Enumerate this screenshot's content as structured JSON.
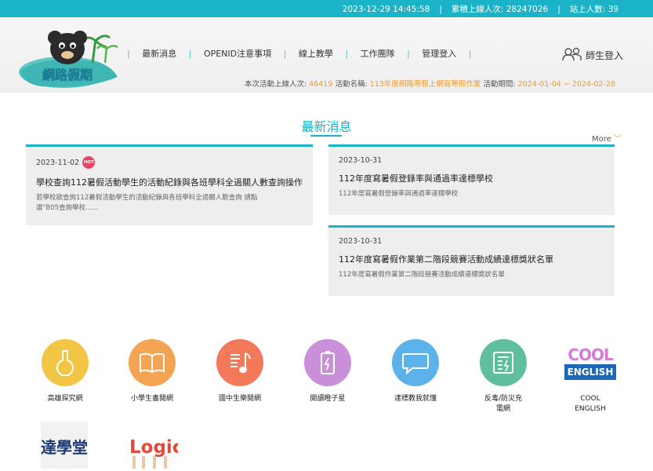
{
  "topbar": {
    "datetime": "2023-12-29 14:45:58",
    "total_label": "累積上線人次: 28247026",
    "online_label": "站上人數: 39"
  },
  "header": {
    "logo_text": "網路假期",
    "nav": [
      "最新消息",
      "OPENID注意事項",
      "線上教學",
      "工作團隊",
      "管理登入"
    ],
    "login_label": "師生登入",
    "info": {
      "visits_label": "本次活動上線人次:",
      "visits_value": "46419",
      "name_label": "活動名稱:",
      "name_value": "113年度網路寒假上網寫寒假作業",
      "period_label": "活動期間:",
      "period_value": "2024-01-04 ~ 2024-02-28"
    }
  },
  "news": {
    "title": "最新消息",
    "more_label": "More",
    "items": [
      {
        "date": "2023-11-02",
        "hot": "HOT",
        "title": "學校查詢112暑假活動學生的活動紀錄與各班學科全過關人數查詢操作",
        "desc": "若學校欲查詢112暑假活動學生的活動紀錄與各班學科全過關人數查詢 請點選\"B05查詢學校......"
      },
      {
        "date": "2023-10-31",
        "title": "112年度寫暑假登錄率與通過率達標學校",
        "desc": "112年度寫暑假登錄率與通過率達標學校"
      },
      {
        "date": "2023-10-31",
        "title": "112年度寫暑假作業第二階段競賽活動成績達標獎狀名單",
        "desc": "112年度寫暑假作業第二階段競賽活動成績達標獎狀名單"
      }
    ]
  },
  "apps": [
    {
      "label": "高雄探究網",
      "color": "#f2c544",
      "icon": "flask-icon"
    },
    {
      "label": "小學生書閱網",
      "color": "#f3a553",
      "icon": "book-icon"
    },
    {
      "label": "國中生樂閱網",
      "color": "#f27a5b",
      "icon": "music-note-icon"
    },
    {
      "label": "閱讀瞪子星",
      "color": "#c98fd8",
      "icon": "battery-icon"
    },
    {
      "label": "達標教我就懂",
      "color": "#5bb3ea",
      "icon": "chat-bubble-icon"
    },
    {
      "label": "反毒/防災充電網",
      "color": "#5fbf9c",
      "icon": "document-icon"
    },
    {
      "label": "COOL ENGLISH",
      "logo_top": "COOL",
      "logo_bottom": "ENGLISH"
    }
  ],
  "extra_tiles": [
    {
      "name": "dah-xue-tang-logo",
      "text": "達學堂"
    },
    {
      "name": "logic-logo",
      "text": "Logic"
    }
  ]
}
